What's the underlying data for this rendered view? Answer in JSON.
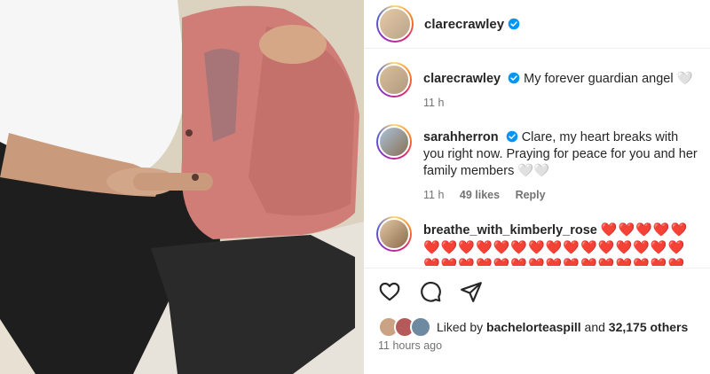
{
  "post": {
    "username": "clarecrawley",
    "colors": {
      "verified": "#0095f6",
      "heart": "#ed4956",
      "muted": "#737373"
    }
  },
  "comments": [
    {
      "username": "clarecrawley",
      "text": "My forever guardian angel 🤍",
      "time": "11 h"
    },
    {
      "username": "sarahherron",
      "text": "Clare, my heart breaks with you right now. Praying for peace for you and her family members 🤍🤍",
      "time": "11 h",
      "likes": "49 likes",
      "reply": "Reply"
    },
    {
      "username": "breathe_with_kimberly_rose",
      "hearts": "❤️❤️❤️❤️❤️❤️❤️❤️❤️❤️❤️❤️❤️❤️❤️❤️❤️❤️❤️❤️❤️❤️❤️❤️❤️❤️❤️❤️❤️❤️❤️❤️❤️❤️❤️"
    }
  ],
  "actions": {
    "icons": [
      "heart-outline-icon",
      "comment-icon",
      "share-icon"
    ]
  },
  "likes": {
    "prefix": "Liked by",
    "user": "bachelorteaspill",
    "middle": "and",
    "others": "32,175 others"
  },
  "timestamp": "11 hours ago"
}
